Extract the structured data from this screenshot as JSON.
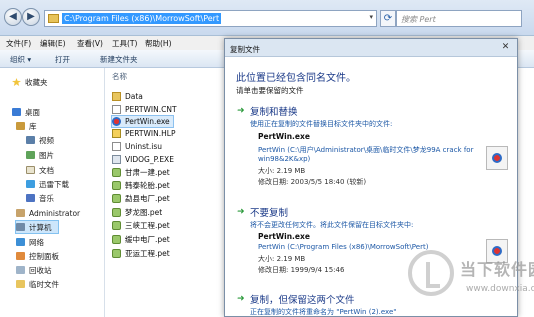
{
  "explorer": {
    "address_path": "C:\\Program Files (x86)\\MorrowSoft\\Pert",
    "search_placeholder": "搜索 Pert",
    "menu": [
      "文件(F)",
      "编辑(E)",
      "查看(V)",
      "工具(T)",
      "帮助(H)"
    ],
    "toolbar": [
      "组织 ▾",
      "打开",
      "新建文件夹"
    ],
    "nav": [
      {
        "label": "收藏夹",
        "icon": "star-icon"
      },
      {
        "label": "桌面",
        "icon": "desktop-icon"
      },
      {
        "label": "库",
        "icon": "library-icon"
      },
      {
        "label": "视频",
        "icon": "video-icon"
      },
      {
        "label": "图片",
        "icon": "pictures-icon"
      },
      {
        "label": "文档",
        "icon": "documents-icon"
      },
      {
        "label": "迅雷下载",
        "icon": "download-icon"
      },
      {
        "label": "音乐",
        "icon": "music-icon"
      },
      {
        "label": "Administrator",
        "icon": "user-icon"
      },
      {
        "label": "计算机",
        "icon": "computer-icon"
      },
      {
        "label": "网络",
        "icon": "network-icon"
      },
      {
        "label": "控制面板",
        "icon": "control-panel-icon"
      },
      {
        "label": "回收站",
        "icon": "recycle-bin-icon"
      },
      {
        "label": "临时文件",
        "icon": "folder-icon"
      }
    ],
    "column_header": "名称",
    "files": [
      {
        "name": "Data",
        "icon": "folder-icon"
      },
      {
        "name": "PERTWIN.CNT",
        "icon": "document-icon"
      },
      {
        "name": "PertWin.exe",
        "icon": "exe-icon"
      },
      {
        "name": "PERTWIN.HLP",
        "icon": "help-file-icon"
      },
      {
        "name": "Uninst.isu",
        "icon": "document-icon"
      },
      {
        "name": "VIDOG_P.EXE",
        "icon": "system-file-icon"
      },
      {
        "name": "甘肃一建.pet",
        "icon": "pet-file-icon"
      },
      {
        "name": "韩泰轮胎.pet",
        "icon": "pet-file-icon"
      },
      {
        "name": "勐县电厂.pet",
        "icon": "pet-file-icon"
      },
      {
        "name": "梦龙图.pet",
        "icon": "pet-file-icon"
      },
      {
        "name": "三峡工程.pet",
        "icon": "pet-file-icon"
      },
      {
        "name": "缓中电厂.pet",
        "icon": "pet-file-icon"
      },
      {
        "name": "亚运工程.pet",
        "icon": "pet-file-icon"
      }
    ]
  },
  "dialog": {
    "title": "复制文件",
    "close_glyph": "✕",
    "heading": "此位置已经包含同名文件。",
    "subheading": "请单击要保留的文件",
    "option_replace": {
      "title": "复制和替换",
      "desc": "使用正在复制的文件替换目标文件夹中的文件:",
      "filename": "PertWin.exe",
      "path_line1": "PertWin (C:\\用户\\Administrator\\桌面\\临时文件\\梦龙99A crack for",
      "path_line2": "win98&2K&xp)",
      "size": "大小: 2.19 MB",
      "modified": "修改日期: 2003/5/5 18:40 (较新)"
    },
    "option_skip": {
      "title": "不要复制",
      "desc": "将不会更改任何文件。将此文件保留在目标文件夹中:",
      "filename": "PertWin.exe",
      "path_line1": "PertWin (C:\\Program Files (x86)\\MorrowSoft\\Pert)",
      "size": "大小: 2.19 MB",
      "modified": "修改日期: 1999/9/4 15:46"
    },
    "option_keep": {
      "title": "复制，但保留这两个文件",
      "desc": "正在复制的文件将重命名为 \"PertWin (2).exe\""
    }
  },
  "watermark": {
    "name": "当下软件园",
    "url": "www.downxia.com"
  }
}
